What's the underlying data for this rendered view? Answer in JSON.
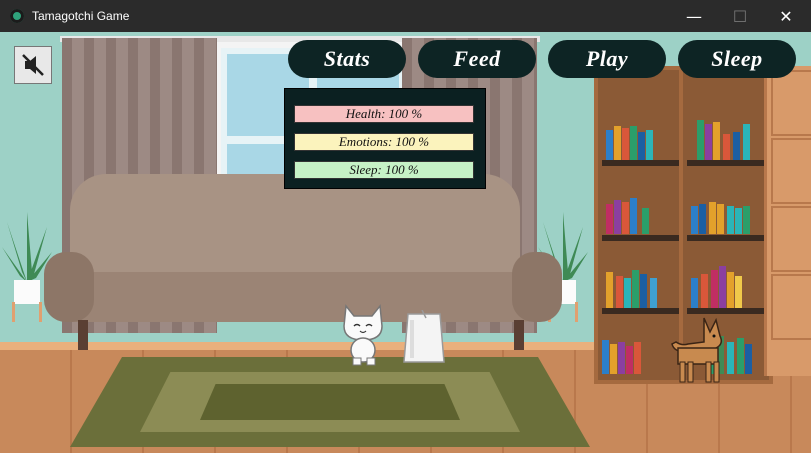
{
  "window": {
    "title": "Tamagotchi Game",
    "min_glyph": "—",
    "max_glyph": "☐",
    "close_glyph": "✕"
  },
  "toolbar": {
    "mute_icon": "speaker-muted-icon"
  },
  "nav": {
    "stats_label": "Stats",
    "feed_label": "Feed",
    "play_label": "Play",
    "sleep_label": "Sleep"
  },
  "stats": {
    "health": {
      "text": "Health: 100 %",
      "value": 100,
      "color": "#f7c1c1"
    },
    "emotions": {
      "text": "Emotions: 100 %",
      "value": 100,
      "color": "#fbf3bd"
    },
    "sleep": {
      "text": "Sleep: 100 %",
      "value": 100,
      "color": "#c6f2c6"
    }
  },
  "colors": {
    "wall": "#9dd1c6",
    "button_bg": "#0d2424",
    "panel_bg": "#0b2021",
    "floor": "#c8895b"
  }
}
